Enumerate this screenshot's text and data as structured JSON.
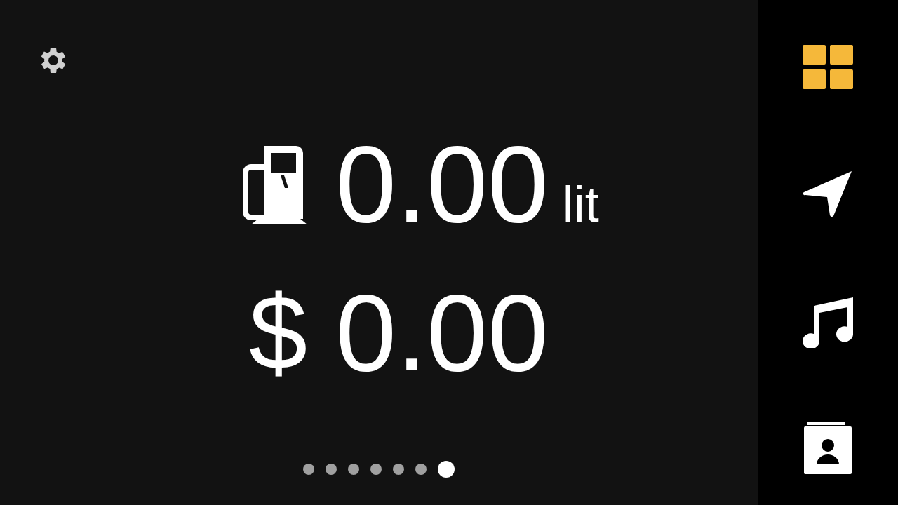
{
  "fuel": {
    "value": "0.00",
    "unit": "lit"
  },
  "cost": {
    "symbol": "$",
    "value": "0.00"
  },
  "pages": [
    {
      "selected": false
    },
    {
      "selected": false
    },
    {
      "selected": false
    },
    {
      "selected": false
    },
    {
      "selected": false
    },
    {
      "selected": false
    },
    {
      "selected": true
    }
  ],
  "sidebar": {
    "items": [
      {
        "kind": "dashboard",
        "selected": true
      },
      {
        "kind": "navigation",
        "selected": false
      },
      {
        "kind": "music",
        "selected": false
      },
      {
        "kind": "contacts",
        "selected": false
      }
    ]
  }
}
